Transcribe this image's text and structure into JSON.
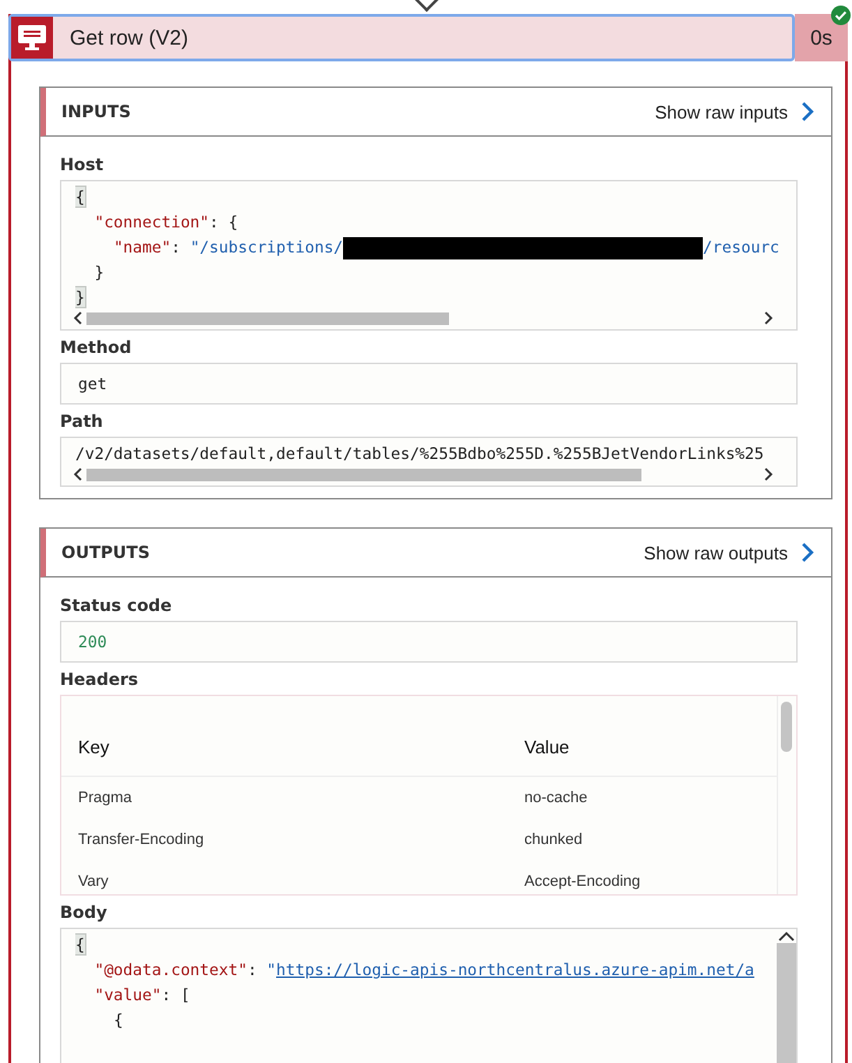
{
  "action": {
    "title": "Get row (V2)",
    "duration": "0s",
    "succeeded": true
  },
  "inputs": {
    "title": "INPUTS",
    "raw_link": "Show raw inputs",
    "fields": [
      {
        "label": "Host",
        "kind": "code",
        "lines": [
          [
            {
              "kind": "punct",
              "text": "{",
              "highlight": true
            }
          ],
          [
            {
              "kind": "key",
              "text": "  \"connection\""
            },
            {
              "kind": "punct",
              "text": ": {"
            }
          ],
          [
            {
              "kind": "key",
              "text": "    \"name\""
            },
            {
              "kind": "punct",
              "text": ": "
            },
            {
              "kind": "string",
              "text": "\"/subscriptions/"
            },
            {
              "kind": "redacted"
            },
            {
              "kind": "string",
              "text": "/resourc"
            }
          ],
          [
            {
              "kind": "punct",
              "text": "  }"
            }
          ],
          [
            {
              "kind": "punct",
              "text": "}",
              "highlight": true
            }
          ]
        ]
      },
      {
        "label": "Method",
        "kind": "text",
        "value": "get"
      },
      {
        "label": "Path",
        "kind": "scrolltext",
        "value": "/v2/datasets/default,default/tables/%255Bdbo%255D.%255BJetVendorLinks%25"
      }
    ]
  },
  "outputs": {
    "title": "OUTPUTS",
    "raw_link": "Show raw outputs",
    "fields": [
      {
        "label": "Status code",
        "kind": "status",
        "value": "200"
      },
      {
        "label": "Headers",
        "kind": "table",
        "columns": [
          "Key",
          "Value"
        ],
        "rows": [
          [
            "Pragma",
            "no-cache"
          ],
          [
            "Transfer-Encoding",
            "chunked"
          ],
          [
            "Vary",
            "Accept-Encoding"
          ]
        ]
      },
      {
        "label": "Body",
        "kind": "code",
        "lines": [
          [
            {
              "kind": "punct",
              "text": "{",
              "highlight": true
            }
          ],
          [
            {
              "kind": "key",
              "text": "  \"@odata.context\""
            },
            {
              "kind": "punct",
              "text": ": "
            },
            {
              "kind": "string",
              "text": "\""
            },
            {
              "kind": "link",
              "text": "https://logic-apis-northcentralus.azure-apim.net/a"
            }
          ],
          [
            {
              "kind": "key",
              "text": "  \"value\""
            },
            {
              "kind": "punct",
              "text": ": ["
            }
          ],
          [
            {
              "kind": "punct",
              "text": "    {"
            }
          ]
        ]
      }
    ]
  }
}
